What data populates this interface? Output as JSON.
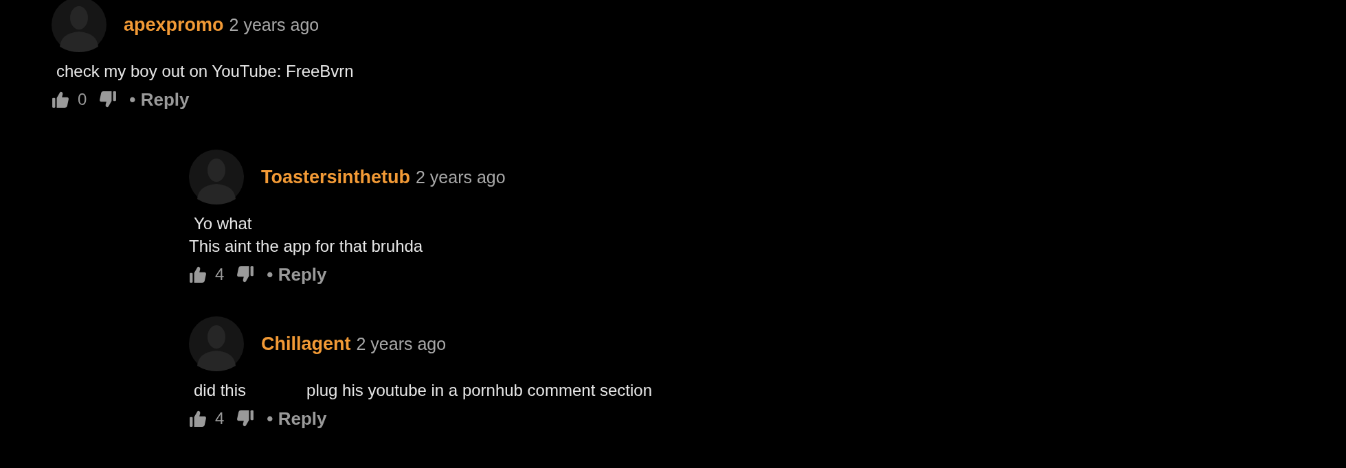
{
  "comments": [
    {
      "username": "apexpromo",
      "time": "2 years ago",
      "lines": [
        [
          "check my boy out on YouTube: FreeBvrn"
        ]
      ],
      "likes": "0",
      "reply": "• Reply",
      "children": [
        {
          "username": "Toastersinthetub",
          "time": "2 years ago",
          "lines": [
            [
              "Yo what"
            ],
            [
              "This aint the app for that bruhda"
            ]
          ],
          "likes": "4",
          "reply": "• Reply"
        },
        {
          "username": "Chillagent",
          "time": "2 years ago",
          "lines": [
            [
              "did this",
              "plug his youtube in a pornhub comment section"
            ]
          ],
          "likes": "4",
          "reply": "• Reply"
        }
      ]
    }
  ]
}
